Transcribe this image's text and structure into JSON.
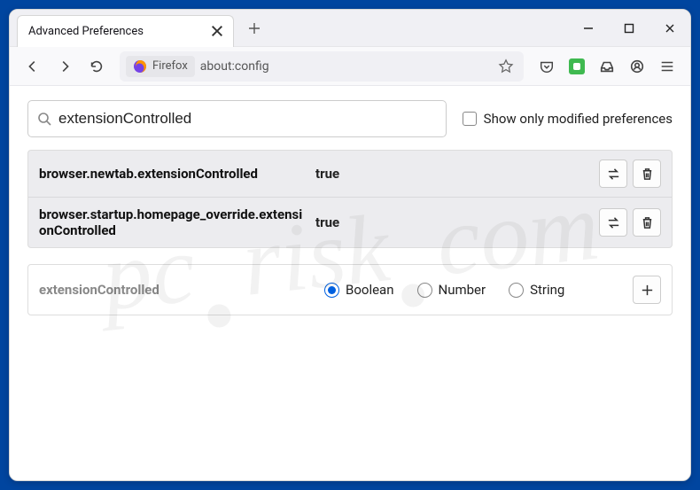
{
  "window": {
    "tab_title": "Advanced Preferences"
  },
  "urlbar": {
    "identity": "Firefox",
    "url": "about:config"
  },
  "search": {
    "value": "extensionControlled",
    "show_modified_label": "Show only modified preferences"
  },
  "prefs": [
    {
      "name": "browser.newtab.extensionControlled",
      "value": "true"
    },
    {
      "name": "browser.startup.homepage_override.extensionControlled",
      "value": "true"
    }
  ],
  "new_pref": {
    "name": "extensionControlled",
    "types": [
      "Boolean",
      "Number",
      "String"
    ],
    "selected": 0
  },
  "watermark": {
    "a": "pc",
    "b": "risk",
    "c": "com"
  }
}
